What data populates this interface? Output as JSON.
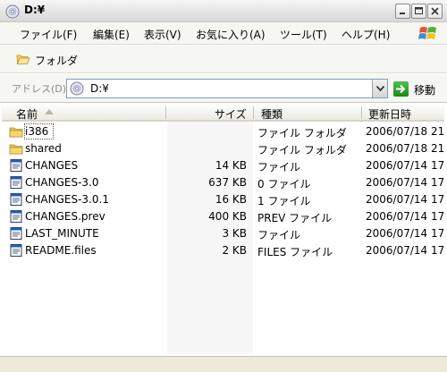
{
  "window": {
    "title": "D:¥"
  },
  "menu": {
    "items": [
      {
        "label": "ファイル(F)"
      },
      {
        "label": "編集(E)"
      },
      {
        "label": "表示(V)"
      },
      {
        "label": "お気に入り(A)"
      },
      {
        "label": "ツール(T)"
      },
      {
        "label": "ヘルプ(H)"
      }
    ]
  },
  "toolbar": {
    "folders_label": "フォルダ"
  },
  "address": {
    "label": "アドレス(D)",
    "value": "D:¥",
    "go_label": "移動"
  },
  "list": {
    "columns": {
      "name": "名前",
      "size": "サイズ",
      "type": "種類",
      "modified": "更新日時"
    },
    "rows": [
      {
        "name": "i386",
        "size": "",
        "type": "ファイル フォルダ",
        "modified": "2006/07/18 21",
        "icon": "folder-icon"
      },
      {
        "name": "shared",
        "size": "",
        "type": "ファイル フォルダ",
        "modified": "2006/07/18 21",
        "icon": "folder-icon"
      },
      {
        "name": "CHANGES",
        "size": "14 KB",
        "type": "ファイル",
        "modified": "2006/07/14 17",
        "icon": "file-icon"
      },
      {
        "name": "CHANGES-3.0",
        "size": "637 KB",
        "type": "0 ファイル",
        "modified": "2006/07/14 17",
        "icon": "file-icon"
      },
      {
        "name": "CHANGES-3.0.1",
        "size": "16 KB",
        "type": "1 ファイル",
        "modified": "2006/07/14 17",
        "icon": "file-icon"
      },
      {
        "name": "CHANGES.prev",
        "size": "400 KB",
        "type": "PREV ファイル",
        "modified": "2006/07/14 17",
        "icon": "file-icon"
      },
      {
        "name": "LAST_MINUTE",
        "size": "3 KB",
        "type": "ファイル",
        "modified": "2006/07/14 17",
        "icon": "file-icon"
      },
      {
        "name": "README.files",
        "size": "2 KB",
        "type": "FILES ファイル",
        "modified": "2006/07/14 17",
        "icon": "file-icon"
      }
    ]
  },
  "colors": {
    "folder": "#e8c14a",
    "go_green": "#2aa22a",
    "address_border": "#7f9db9"
  }
}
